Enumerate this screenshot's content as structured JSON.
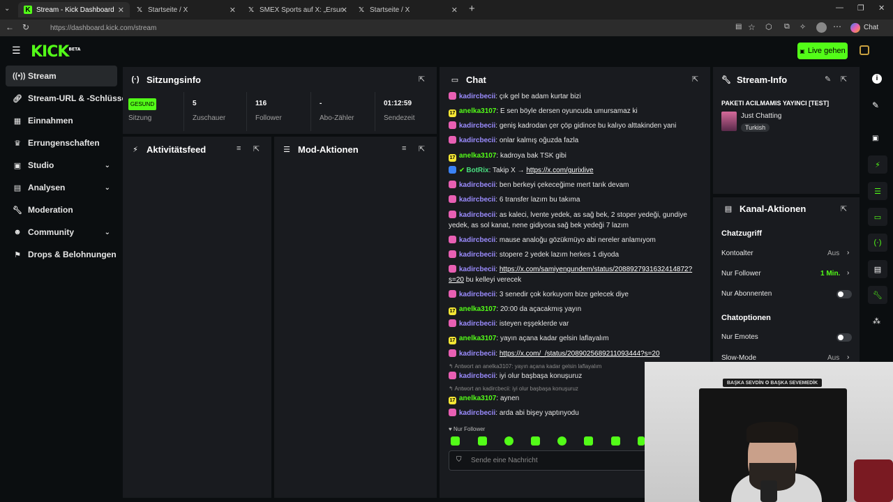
{
  "browser": {
    "tabs": [
      {
        "title": "Stream - Kick Dashboard",
        "icon": "kick-icon"
      },
      {
        "title": "Startseite / X",
        "icon": "x-icon"
      },
      {
        "title": "SMEX Sports auf X: „Ersun Yanal: '",
        "icon": "x-icon"
      },
      {
        "title": "Startseite / X",
        "icon": "x-icon"
      }
    ],
    "url": "https://dashboard.kick.com/stream",
    "chat_label": "Chat"
  },
  "header": {
    "logo": "KICK",
    "logo_badge": "BETA",
    "live_button": "Live gehen"
  },
  "sidebar": {
    "items": [
      {
        "label": "Stream",
        "icon": "broadcast-icon",
        "chevron": false
      },
      {
        "label": "Stream-URL & -Schlüssel",
        "icon": "link-icon",
        "chevron": false
      },
      {
        "label": "Einnahmen",
        "icon": "money-icon",
        "chevron": false
      },
      {
        "label": "Errungenschaften",
        "icon": "trophy-icon",
        "chevron": false
      },
      {
        "label": "Studio",
        "icon": "studio-icon",
        "chevron": true
      },
      {
        "label": "Analysen",
        "icon": "chart-icon",
        "chevron": true
      },
      {
        "label": "Moderation",
        "icon": "wrench-icon",
        "chevron": false
      },
      {
        "label": "Community",
        "icon": "people-icon",
        "chevron": true
      },
      {
        "label": "Drops & Belohnungen",
        "icon": "gift-icon",
        "chevron": false
      }
    ]
  },
  "session": {
    "title": "Sitzungsinfo",
    "health": "GESUND",
    "health_label": "Sitzung",
    "stats": [
      {
        "value": "5",
        "label": "Zuschauer"
      },
      {
        "value": "116",
        "label": "Follower"
      },
      {
        "value": "-",
        "label": "Abo-Zähler"
      },
      {
        "value": "01:12:59",
        "label": "Sendezeit"
      }
    ]
  },
  "activity": {
    "title": "Aktivitätsfeed"
  },
  "mod": {
    "title": "Mod-Aktionen"
  },
  "chat": {
    "title": "Chat",
    "messages": [
      {
        "user": "kadircbecii",
        "badge": "pink",
        "text": "çık gel be adam kurtar bizi"
      },
      {
        "user": "anelka3107",
        "badge": "yel",
        "text": "E sen böyle dersen oyuncuda umursamaz ki"
      },
      {
        "user": "kadircbecii",
        "badge": "pink",
        "text": "geniş kadrodan çer çöp gidince bu kalıyo alttakinden yani"
      },
      {
        "user": "kadircbecii",
        "badge": "pink",
        "text": "onlar kalmış oğuzda fazla"
      },
      {
        "user": "anelka3107",
        "badge": "yel",
        "text": "kadroya bak TSK gibi"
      },
      {
        "user": "BotRix",
        "badge": "blue",
        "text": "Takip X → ",
        "link": "https://x.com/gurixlive"
      },
      {
        "user": "kadircbecii",
        "badge": "pink",
        "text": "ben berkeyi çekeceğime mert tarık devam"
      },
      {
        "user": "kadircbecii",
        "badge": "pink",
        "text": "6 transfer lazım bu takıma"
      },
      {
        "user": "kadircbecii",
        "badge": "pink",
        "text": "as kaleci, lvente yedek, as sağ bek, 2 stoper yedeği, gundiye yedek, as sol kanat, nene gidiyosa sağ bek yedeği 7 lazım"
      },
      {
        "user": "kadircbecii",
        "badge": "pink",
        "text": "mause analoğu gözükmüyo abi nereler anlamıyom"
      },
      {
        "user": "kadircbecii",
        "badge": "pink",
        "text": "stopere 2 yedek lazım herkes 1 diyoda"
      },
      {
        "user": "kadircbecii",
        "badge": "pink",
        "text": " bu kelleyi verecek",
        "link": "https://x.com/samiyengundem/status/2088927931632414872?s=20"
      },
      {
        "user": "kadircbecii",
        "badge": "pink",
        "text": "3 senedir çok korkuyom bize gelecek diye"
      },
      {
        "user": "anelka3107",
        "badge": "yel",
        "text": "20:00 da açacakmış yayın"
      },
      {
        "user": "kadircbecii",
        "badge": "pink",
        "text": "isteyen eşşeklerde var"
      },
      {
        "user": "anelka3107",
        "badge": "yel",
        "text": "yayın açana kadar gelsin laflayalım"
      },
      {
        "user": "kadircbecii",
        "badge": "pink",
        "text": "",
        "link": "https://x.com/_/status/2089025689211093444?s=20"
      },
      {
        "user": "kadircbecii",
        "badge": "pink",
        "text": "iyi olur başbaşa konuşuruz",
        "reply": "Antwort an anelka3107: yayın açana kadar gelsin laflayalım"
      },
      {
        "user": "anelka3107",
        "badge": "yel",
        "text": "aynen",
        "reply": "Antwort an kadircbecii: iyi olur başbaşa konuşuruz"
      },
      {
        "user": "kadircbecii",
        "badge": "pink",
        "text": "arda abi bişey yaptınyodu"
      }
    ],
    "follower_only": "Nur Follower",
    "input_placeholder": "Sende eine Nachricht"
  },
  "stream_info": {
    "title": "Stream-Info",
    "stream_title": "PAKETI ACILMAMIS YAYINCI [TEST]",
    "category": "Just Chatting",
    "tag": "Turkish"
  },
  "channel_actions": {
    "title": "Kanal-Aktionen",
    "chat_access": "Chatzugriff",
    "account_age": "Kontoalter",
    "account_age_value": "Aus",
    "followers_only": "Nur Follower",
    "followers_only_value": "1 Min.",
    "subs_only": "Nur Abonnenten",
    "chat_options": "Chatoptionen",
    "emotes_only": "Nur Emotes",
    "slow_mode": "Slow-Mode",
    "slow_mode_value": "Aus"
  },
  "webcam": {
    "banner_text": "BAŞKA SEVDİN ✪ BAŞKA SEVEMEDİK"
  }
}
